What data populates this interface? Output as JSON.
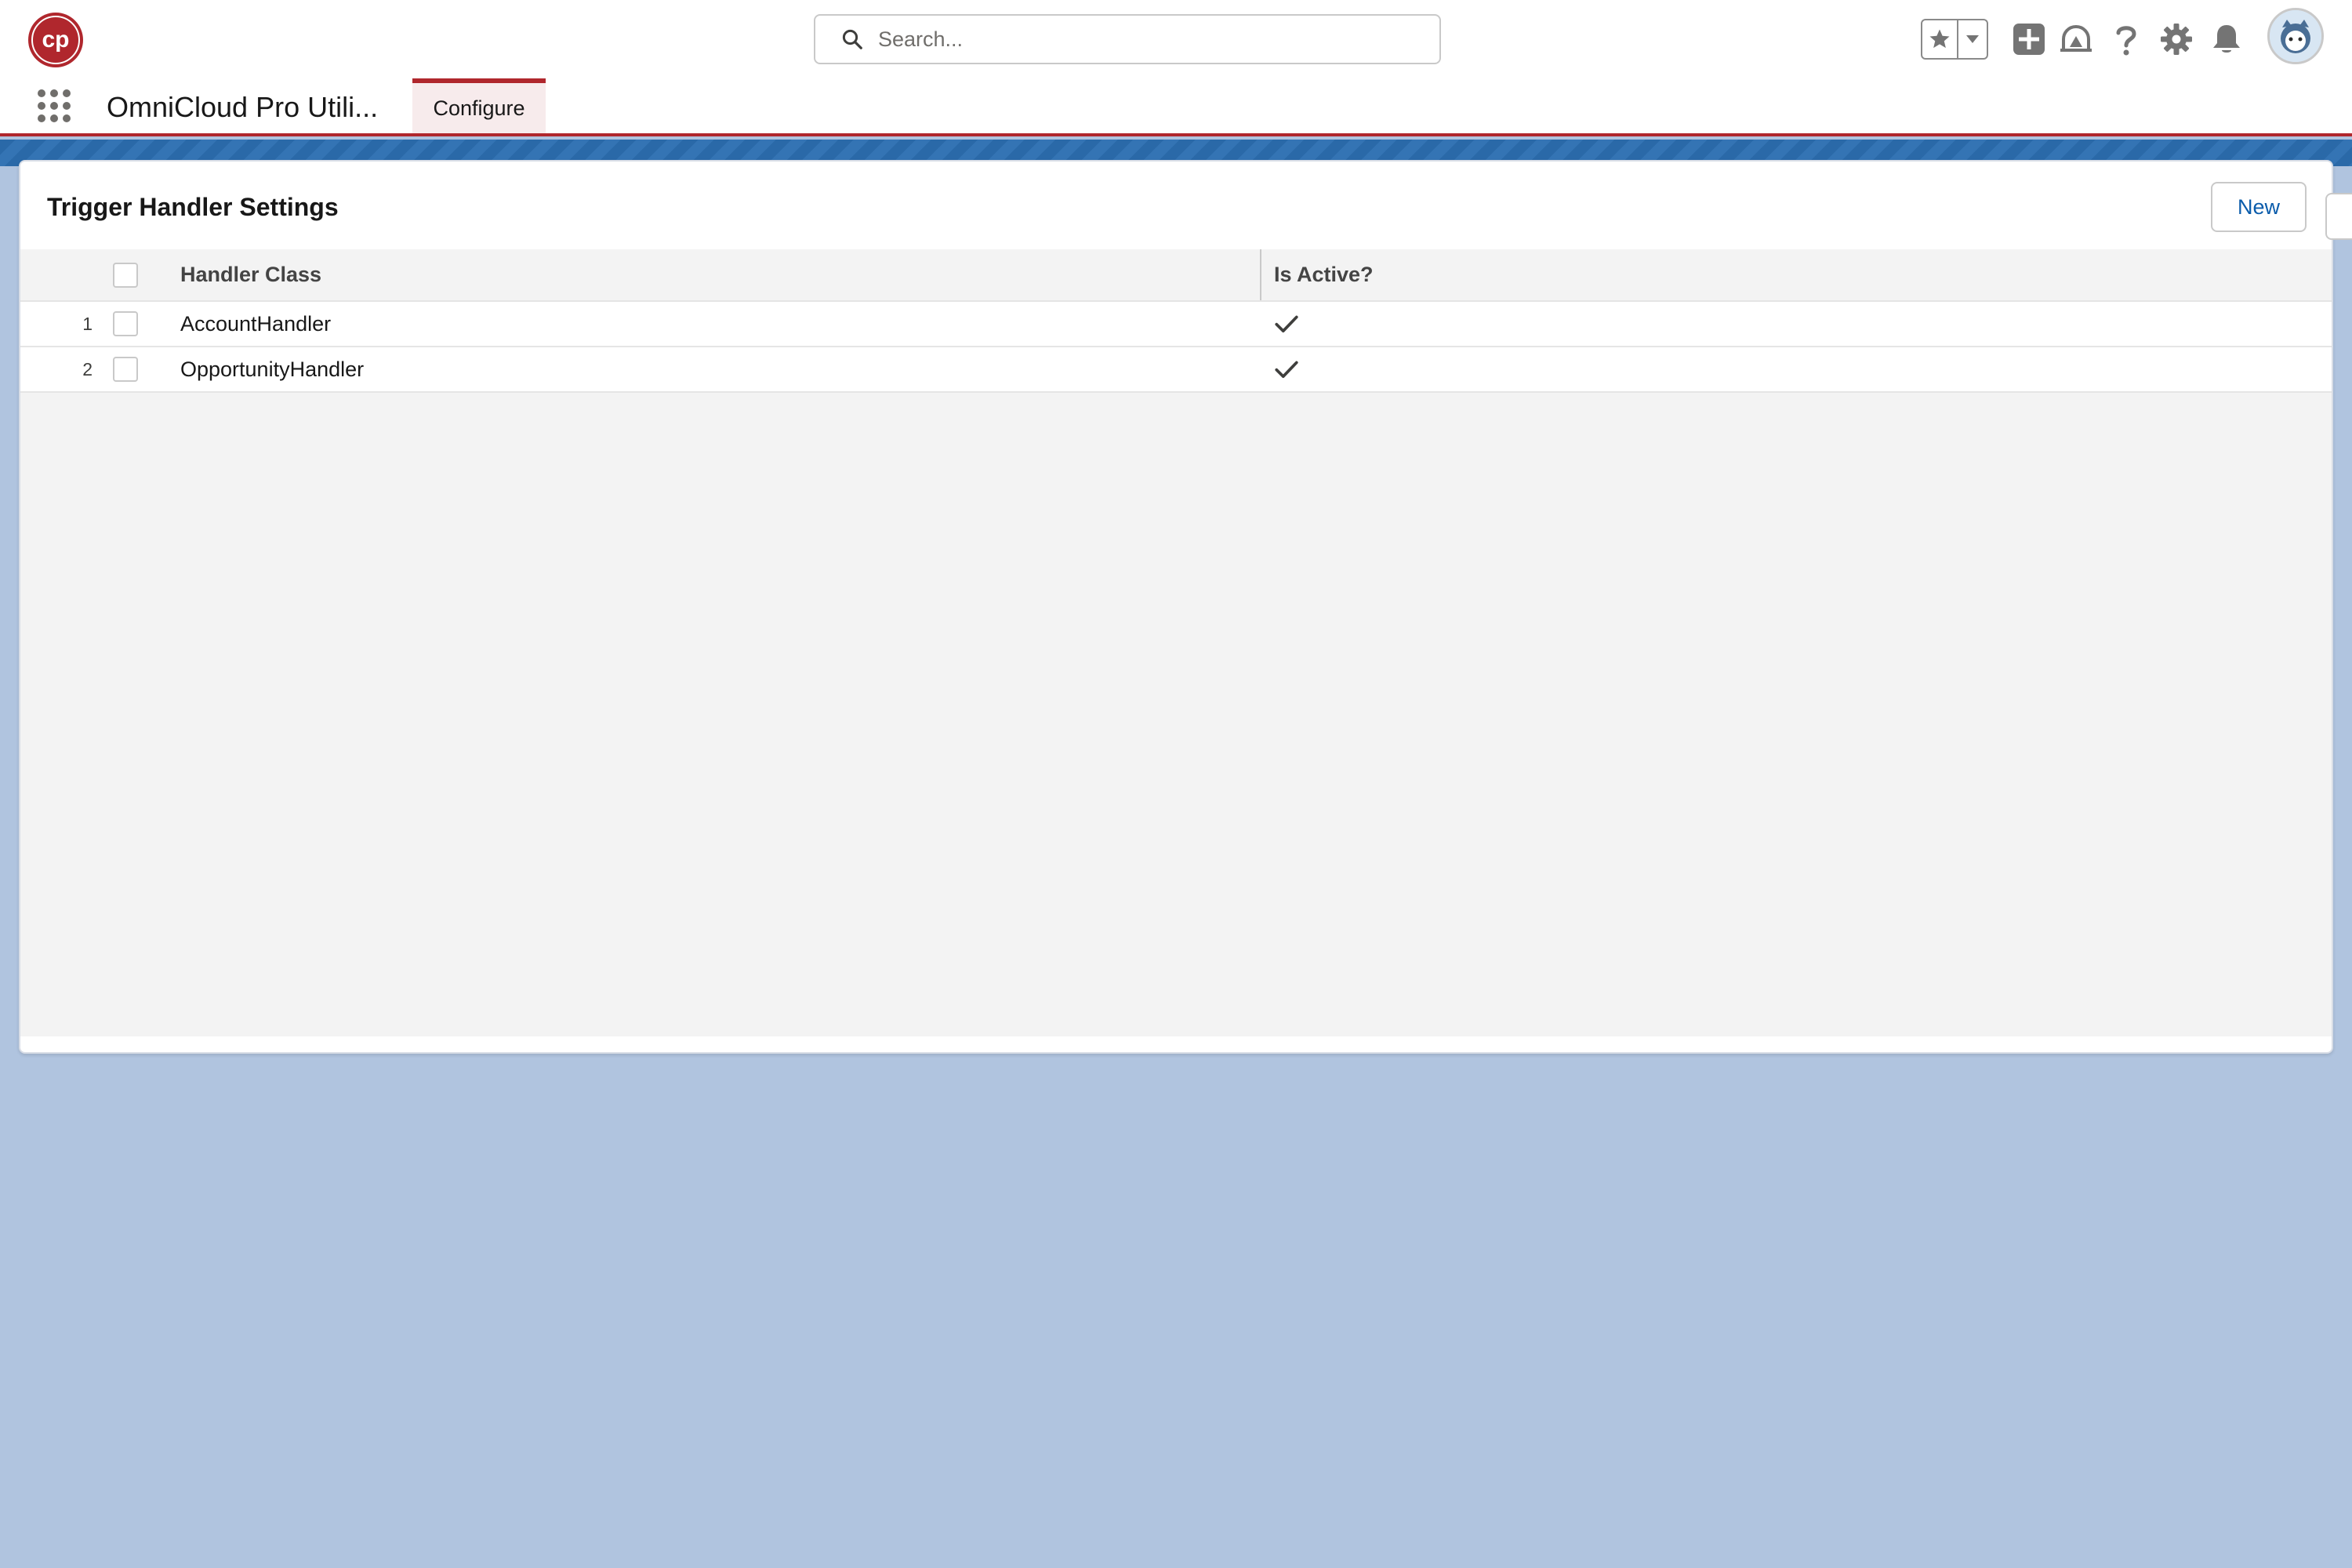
{
  "header": {
    "logo_text": "cp",
    "search_placeholder": "Search...",
    "icons": [
      "favorites-star-icon",
      "favorites-dropdown-icon",
      "global-actions-icon",
      "trailhead-icon",
      "help-icon",
      "setup-gear-icon",
      "notifications-bell-icon",
      "user-avatar"
    ]
  },
  "nav": {
    "app_name": "OmniCloud Pro Utili...",
    "tabs": [
      {
        "label": "Configure",
        "active": true
      }
    ]
  },
  "card": {
    "title": "Trigger Handler Settings",
    "new_button_label": "New",
    "columns": {
      "handler_class": "Handler Class",
      "is_active": "Is Active?"
    },
    "rows": [
      {
        "num": "1",
        "handler_class": "AccountHandler",
        "is_active": true
      },
      {
        "num": "2",
        "handler_class": "OpportunityHandler",
        "is_active": true
      }
    ]
  },
  "colors": {
    "brand_red": "#b0272d",
    "link_blue": "#0b5cab",
    "background": "#b0c4df",
    "banner_blue": "#2a69a8"
  }
}
